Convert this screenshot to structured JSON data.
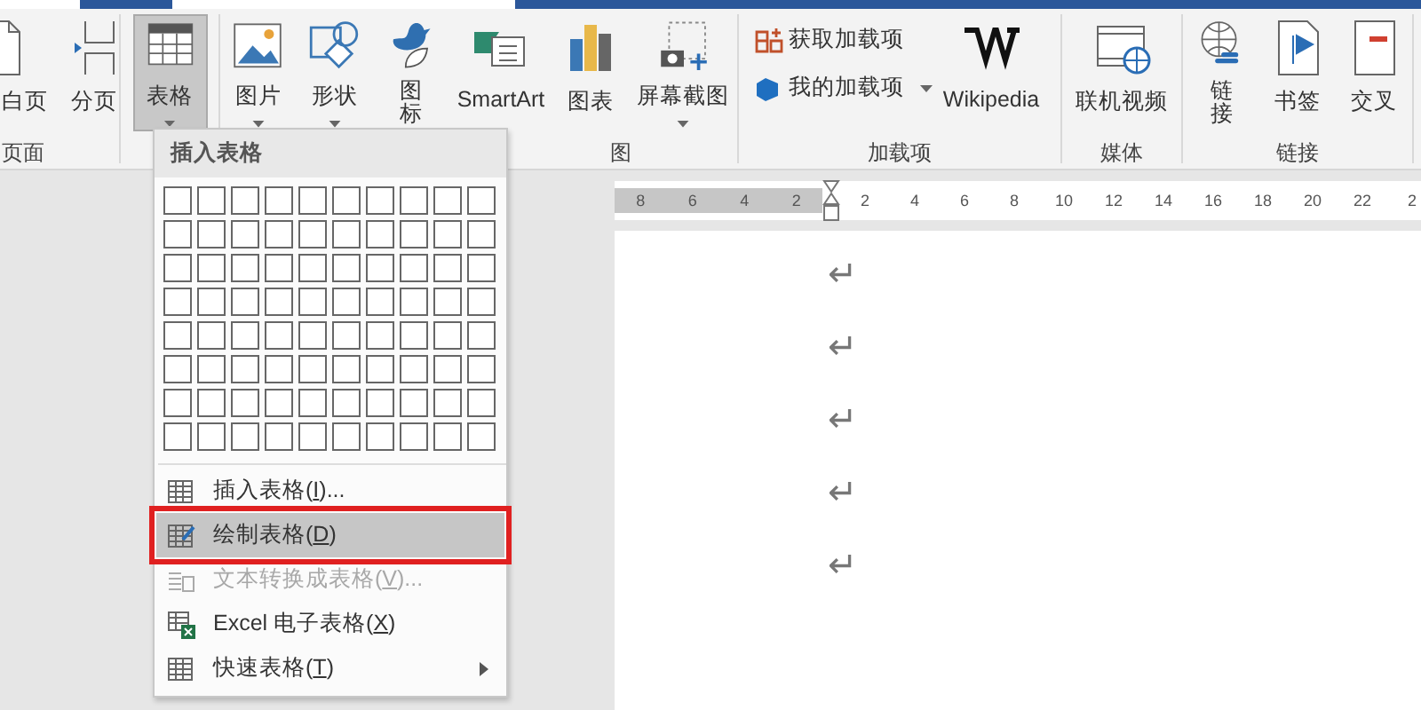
{
  "ribbon": {
    "groups": [
      {
        "label": "页面",
        "buttons": [
          {
            "label": "白页",
            "kind": "large",
            "dropdown": false,
            "selected": false
          },
          {
            "label": "分页",
            "kind": "large",
            "dropdown": false,
            "selected": false
          }
        ]
      },
      {
        "buttons": [
          {
            "label": "表格",
            "kind": "large",
            "dropdown": true,
            "selected": true
          }
        ]
      },
      {
        "label": "图",
        "buttons": [
          {
            "label": "图片",
            "kind": "large",
            "dropdown": true,
            "selected": false
          },
          {
            "label": "形状",
            "kind": "large",
            "dropdown": true,
            "selected": false
          },
          {
            "label": "图标",
            "kind": "narrow",
            "dropdown": false,
            "selected": false
          },
          {
            "label": "SmartArt",
            "kind": "large",
            "dropdown": false,
            "selected": false
          },
          {
            "label": "图表",
            "kind": "large",
            "dropdown": false,
            "selected": false
          },
          {
            "label": "屏幕截图",
            "kind": "large",
            "dropdown": true,
            "selected": false
          }
        ]
      },
      {
        "label": "加载项",
        "buttons": [
          {
            "label": "获取加载项",
            "kind": "small",
            "dropdown": false,
            "selected": false
          },
          {
            "label": "我的加载项",
            "kind": "small",
            "dropdown": true,
            "selected": false
          },
          {
            "label": "Wikipedia",
            "kind": "large",
            "dropdown": false,
            "selected": false
          }
        ]
      },
      {
        "label": "媒体",
        "buttons": [
          {
            "label": "联机视频",
            "kind": "large",
            "dropdown": false,
            "selected": false
          }
        ]
      },
      {
        "label": "链接",
        "buttons": [
          {
            "label": "链接",
            "kind": "narrow",
            "dropdown": false,
            "selected": false
          },
          {
            "label": "书签",
            "kind": "large",
            "dropdown": false,
            "selected": false
          },
          {
            "label": "交叉",
            "kind": "large",
            "dropdown": false,
            "selected": false
          }
        ]
      }
    ]
  },
  "table_menu": {
    "header": "插入表格",
    "items": [
      {
        "label": "插入表格(",
        "accel": "I",
        "tail": ")...",
        "disabled": false,
        "highlighted": false,
        "submenu": false
      },
      {
        "label": "绘制表格(",
        "accel": "D",
        "tail": ")",
        "disabled": false,
        "highlighted": true,
        "submenu": false
      },
      {
        "label": "文本转换成表格(",
        "accel": "V",
        "tail": ")...",
        "disabled": true,
        "highlighted": false,
        "submenu": false
      },
      {
        "label": "Excel 电子表格(",
        "accel": "X",
        "tail": ")",
        "disabled": false,
        "highlighted": false,
        "submenu": false
      },
      {
        "label": "快速表格(",
        "accel": "T",
        "tail": ")",
        "disabled": false,
        "highlighted": false,
        "submenu": true
      }
    ]
  },
  "ruler": {
    "left_ticks": [
      "8",
      "6",
      "4",
      "2"
    ],
    "right_ticks": [
      "2",
      "4",
      "6",
      "8",
      "10",
      "12",
      "14",
      "16",
      "18",
      "20",
      "22",
      "2"
    ]
  },
  "document": {
    "paragraph_marks": [
      "↵",
      "↵",
      "↵",
      "↵",
      "↵"
    ]
  }
}
